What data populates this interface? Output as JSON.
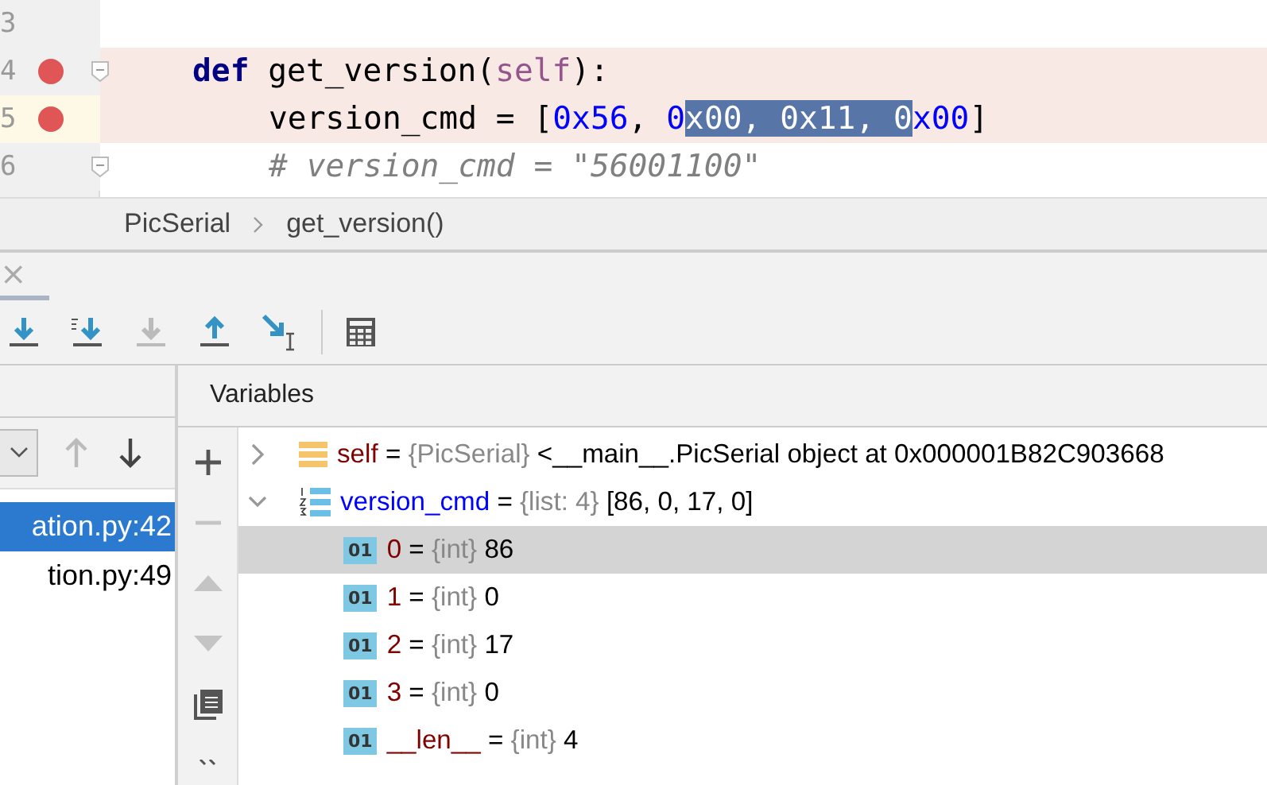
{
  "editor": {
    "lines": [
      {
        "number": "3",
        "breakpoint": false,
        "highlighted": false,
        "current": false,
        "fold": false
      },
      {
        "number": "4",
        "kind": "def",
        "breakpoint": true,
        "highlighted": true,
        "current": false,
        "fold": true,
        "tokens": [
          {
            "kind": "keyword",
            "text": "def"
          },
          {
            "kind": "plain",
            "text": " get_version("
          },
          {
            "kind": "self",
            "text": "self"
          },
          {
            "kind": "plain",
            "text": "):"
          }
        ]
      },
      {
        "number": "5",
        "kind": "body",
        "breakpoint": true,
        "highlighted": true,
        "current": true,
        "fold": false,
        "tokens": [
          {
            "kind": "plain",
            "text": "version_cmd = ["
          },
          {
            "kind": "number",
            "text": "0x56"
          },
          {
            "kind": "plain",
            "text": ", "
          },
          {
            "kind": "number",
            "text": "0"
          },
          {
            "kind": "selection",
            "text": "x00, 0x11, 0"
          },
          {
            "kind": "number",
            "text": "x00"
          },
          {
            "kind": "plain",
            "text": "]"
          }
        ]
      },
      {
        "number": "6",
        "kind": "body",
        "breakpoint": false,
        "highlighted": false,
        "current": false,
        "fold": true,
        "tokens": [
          {
            "kind": "comment",
            "text": "# version_cmd = \"56001100\""
          }
        ]
      }
    ]
  },
  "breadcrumb": [
    "PicSerial",
    "get_version()"
  ],
  "debug_tab": {
    "close": "×"
  },
  "toolbar": [
    {
      "kind": "step-over",
      "disabled": false
    },
    {
      "kind": "step-into-my",
      "disabled": false
    },
    {
      "kind": "step-into-force",
      "disabled": true
    },
    {
      "kind": "step-out",
      "disabled": false
    },
    {
      "kind": "run-to-cursor",
      "disabled": false
    },
    {
      "kind": "evaluate",
      "disabled": false
    }
  ],
  "frames": {
    "items": [
      {
        "label": "ation.py:42",
        "selected": true
      },
      {
        "label": "tion.py:49",
        "selected": false
      }
    ],
    "up_disabled": true,
    "down_disabled": false
  },
  "variables": {
    "title": "Variables",
    "side_buttons": [
      {
        "kind": "add",
        "disabled": false
      },
      {
        "kind": "remove",
        "disabled": true
      },
      {
        "kind": "up",
        "disabled": true
      },
      {
        "kind": "down",
        "disabled": true
      },
      {
        "kind": "copy",
        "disabled": false
      },
      {
        "kind": "more",
        "disabled": false
      }
    ],
    "items": [
      {
        "name": "self",
        "equals": "=",
        "type": "{PicSerial}",
        "value": "<__main__.PicSerial object at 0x000001B82C903668",
        "kind": "object",
        "expanded": false,
        "selected": false
      },
      {
        "name": "version_cmd",
        "equals": "=",
        "type": "{list: 4}",
        "value": "[86, 0, 17, 0]",
        "kind": "list",
        "expanded": true,
        "selected": false,
        "children": [
          {
            "badge": "01",
            "name": "0",
            "equals": "=",
            "type": "{int}",
            "value": "86",
            "kind": "int",
            "selected": true
          },
          {
            "badge": "01",
            "name": "1",
            "equals": "=",
            "type": "{int}",
            "value": "0",
            "kind": "int",
            "selected": false
          },
          {
            "badge": "01",
            "name": "2",
            "equals": "=",
            "type": "{int}",
            "value": "17",
            "kind": "int",
            "selected": false
          },
          {
            "badge": "01",
            "name": "3",
            "equals": "=",
            "type": "{int}",
            "value": "0",
            "kind": "int",
            "selected": false
          },
          {
            "badge": "01",
            "name": "__len__",
            "equals": "=",
            "type": "{int}",
            "value": "4",
            "kind": "int",
            "selected": false
          }
        ]
      }
    ]
  }
}
